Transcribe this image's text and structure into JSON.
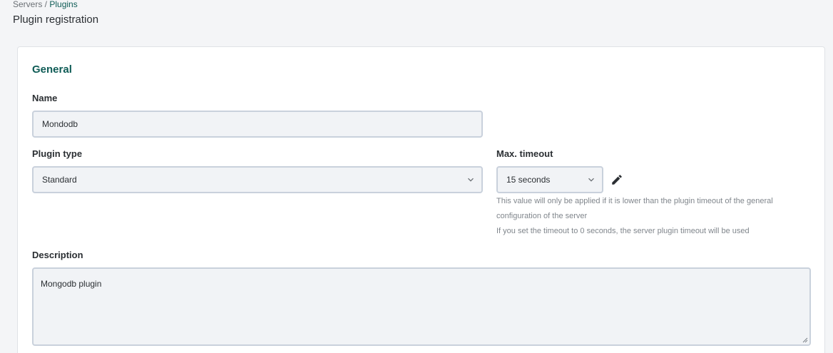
{
  "breadcrumb": {
    "parent": "Servers",
    "separator": " / ",
    "current": "Plugins"
  },
  "page_title": "Plugin registration",
  "general": {
    "title": "General",
    "name": {
      "label": "Name",
      "value": "Mondodb"
    },
    "plugin_type": {
      "label": "Plugin type",
      "value": "Standard"
    },
    "max_timeout": {
      "label": "Max. timeout",
      "value": "15 seconds",
      "help_line1": "This value will only be applied if it is lower than the plugin timeout of the general configuration of the server",
      "help_line2": "If you set the timeout to 0 seconds, the server plugin timeout will be used"
    },
    "description": {
      "label": "Description",
      "value": "Mongodb plugin"
    }
  },
  "colors": {
    "accent": "#0f5c56",
    "field_bg": "#f1f3f6",
    "field_border": "#c9d1dc"
  },
  "icons": {
    "select_arrow": "chevron-down-icon",
    "edit": "pencil-icon"
  }
}
